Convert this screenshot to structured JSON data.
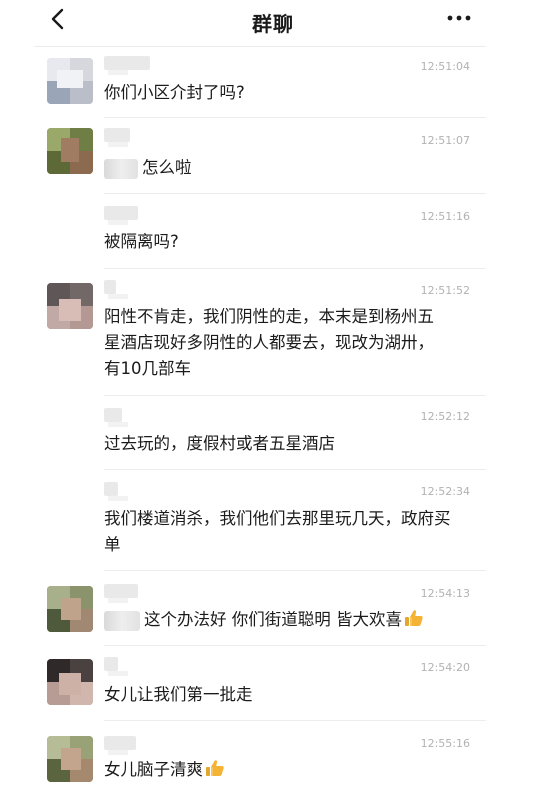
{
  "header": {
    "title": "群聊",
    "back_icon": "chevron-left-icon",
    "more_icon": "ellipsis-icon"
  },
  "messages": [
    {
      "time": "12:51:04",
      "text": "你们小区介封了吗?"
    },
    {
      "time": "12:51:07",
      "text": "怎么啦",
      "has_mention": true
    },
    {
      "time": "12:51:16",
      "text": "被隔离吗?"
    },
    {
      "time": "12:51:52",
      "text": "阳性不肯走，我们阴性的走，本末是到杨州五星酒店现好多阴性的人都要去，现改为湖卅，有10几部车"
    },
    {
      "time": "12:52:12",
      "text": "过去玩的，度假村或者五星酒店"
    },
    {
      "time": "12:52:34",
      "text": "我们楼道消杀，我们他们去那里玩几天，政府买单"
    },
    {
      "time": "12:54:13",
      "text": "这个办法好 你们街道聪明 皆大欢喜",
      "has_mention": true,
      "emoji": "thumbs-up-icon"
    },
    {
      "time": "12:54:20",
      "text": "女儿让我们第一批走"
    },
    {
      "time": "12:55:16",
      "text": "女儿脑子清爽",
      "emoji": "thumbs-up-icon"
    }
  ],
  "colors": {
    "time": "#b2b2b2",
    "divider": "#ededed",
    "thumb": "#f5b335"
  }
}
